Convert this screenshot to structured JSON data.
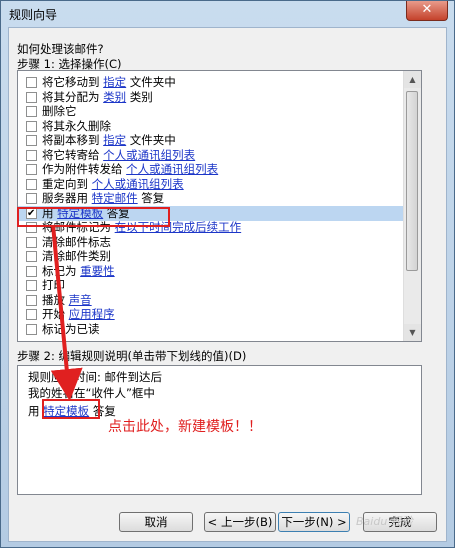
{
  "window": {
    "title": "规则向导",
    "close_label": "✕"
  },
  "question": "如何处理该邮件?",
  "step1_label": "步骤 1: 选择操作(C)",
  "actions": [
    {
      "checked": false,
      "text": "将它移动到",
      "link": "指定",
      "tail": "文件夹中"
    },
    {
      "checked": false,
      "text": "将其分配为",
      "link": "类别",
      "tail": "类别"
    },
    {
      "checked": false,
      "text": "删除它",
      "link": "",
      "tail": ""
    },
    {
      "checked": false,
      "text": "将其永久删除",
      "link": "",
      "tail": ""
    },
    {
      "checked": false,
      "text": "将副本移到",
      "link": "指定",
      "tail": "文件夹中"
    },
    {
      "checked": false,
      "text": "将它转寄给",
      "link": "个人或通讯组列表",
      "tail": ""
    },
    {
      "checked": false,
      "text": "作为附件转发给",
      "link": "个人或通讯组列表",
      "tail": ""
    },
    {
      "checked": false,
      "text": "重定向到",
      "link": "个人或通讯组列表",
      "tail": ""
    },
    {
      "checked": false,
      "text": "服务器用",
      "link": "特定邮件",
      "tail": "答复"
    },
    {
      "checked": true,
      "text": "用",
      "link": "特定模板",
      "tail": "答复"
    },
    {
      "checked": false,
      "text": "将邮件标记为",
      "link": "在以下时间完成后续工作",
      "tail": ""
    },
    {
      "checked": false,
      "text": "清除邮件标志",
      "link": "",
      "tail": ""
    },
    {
      "checked": false,
      "text": "清除邮件类别",
      "link": "",
      "tail": ""
    },
    {
      "checked": false,
      "text": "标记为",
      "link": "重要性",
      "tail": ""
    },
    {
      "checked": false,
      "text": "打印",
      "link": "",
      "tail": ""
    },
    {
      "checked": false,
      "text": "播放",
      "link": "声音",
      "tail": ""
    },
    {
      "checked": false,
      "text": "开始",
      "link": "应用程序",
      "tail": ""
    },
    {
      "checked": false,
      "text": "标记为已读",
      "link": "",
      "tail": ""
    }
  ],
  "step2_label": "步骤 2: 编辑规则说明(单击带下划线的值)(D)",
  "description": {
    "line1": "规则应用时间: 邮件到达后",
    "line2": "我的姓名在“收件人”框中",
    "line3_prefix": "用",
    "line3_link": "特定模板",
    "line3_suffix": "答复"
  },
  "annotation": "点击此处，新建模板！！",
  "buttons": {
    "cancel": "取消",
    "back": "< 上一步(B)",
    "next": "下一步(N) >",
    "finish": "完成"
  },
  "watermark": "Baidu 经验",
  "colors": {
    "link": "#1c36c8",
    "highlight": "#e02020",
    "selection": "#bcd6f1"
  }
}
